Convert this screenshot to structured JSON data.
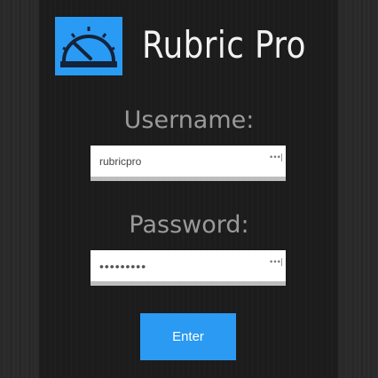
{
  "app": {
    "title": "Rubric Pro",
    "logo_icon": "speedometer-icon",
    "accent_color": "#2a9bf4"
  },
  "login": {
    "username_label": "Username:",
    "username_value": "rubricpro",
    "password_label": "Password:",
    "password_value": "rubricpro",
    "field_icon": "password-manager-icon",
    "field_icon_glyph": "•••|",
    "submit_label": "Enter"
  }
}
